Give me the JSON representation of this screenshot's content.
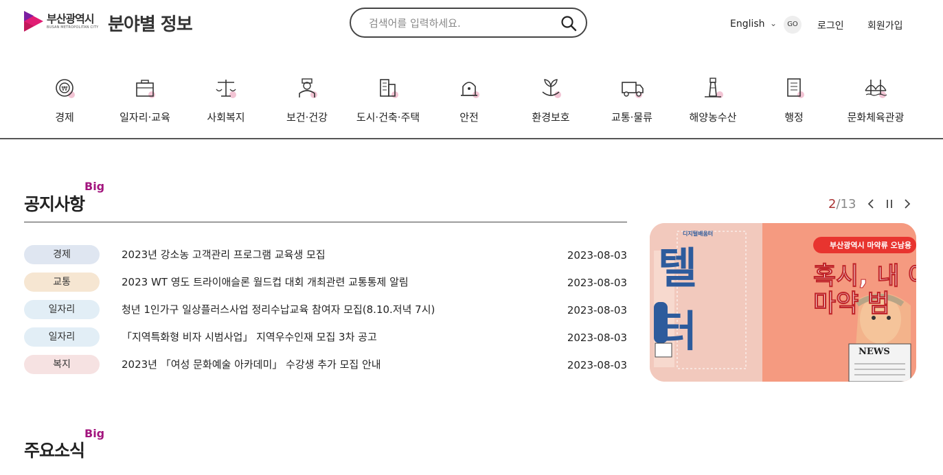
{
  "header": {
    "logo_name": "부산광역시",
    "logo_sub": "BUSAN METROPOLITAN CITY",
    "site_title": "분야별 정보",
    "search_placeholder": "검색어를 입력하세요.",
    "lang": "English",
    "go": "GO",
    "login": "로그인",
    "join": "회원가입"
  },
  "nav": {
    "items": [
      {
        "label": "경제",
        "icon": "economy-icon"
      },
      {
        "label": "일자리·교육",
        "icon": "briefcase-icon"
      },
      {
        "label": "사회복지",
        "icon": "scale-icon"
      },
      {
        "label": "보건·건강",
        "icon": "doctor-icon"
      },
      {
        "label": "도시·건축·주택",
        "icon": "building-icon"
      },
      {
        "label": "안전",
        "icon": "siren-icon"
      },
      {
        "label": "환경보호",
        "icon": "plant-icon"
      },
      {
        "label": "교통·물류",
        "icon": "truck-icon"
      },
      {
        "label": "해양농수산",
        "icon": "lighthouse-icon"
      },
      {
        "label": "행정",
        "icon": "document-icon"
      },
      {
        "label": "문화체육관광",
        "icon": "bridge-icon"
      }
    ]
  },
  "notice": {
    "title": "공지사항",
    "big": "Big",
    "rows": [
      {
        "cat": "경제",
        "color": "#dfe6f1",
        "text": "2023년 강소농 고객관리 프로그램 교육생 모집",
        "date": "2023-08-03"
      },
      {
        "cat": "교통",
        "color": "#f6e6d2",
        "text": "2023 WT 영도 트라이애슬론 월드컵 대회 개최관련 교통통제 알림",
        "date": "2023-08-03"
      },
      {
        "cat": "일자리",
        "color": "#e2eef6",
        "text": "청년 1인가구 일상플러스사업 정리수납교육 참여자 모집(8.10.저녁 7시)",
        "date": "2023-08-03"
      },
      {
        "cat": "일자리",
        "color": "#e2eef6",
        "text": "「지역특화형 비자 시범사업」 지역우수인재 모집 3차 공고",
        "date": "2023-08-03"
      },
      {
        "cat": "복지",
        "color": "#f6e2e2",
        "text": "2023년 「여성 문화예술 아카데미」 수강생 추가 모집 안내",
        "date": "2023-08-03"
      }
    ]
  },
  "banner": {
    "current": "2",
    "total": "/13",
    "org": "디지털배움터",
    "tag": "부산광역시 마약류 오남용",
    "headline1": "혹시, 내 아",
    "headline2": "마약 범",
    "side_text": "텔 터",
    "news": "NEWS"
  },
  "news_section": {
    "title": "주요소식",
    "big": "Big"
  },
  "colors": {
    "accent": "#a3157e",
    "banner_bg": "#f6b7a6",
    "banner_red": "#e8342f"
  }
}
